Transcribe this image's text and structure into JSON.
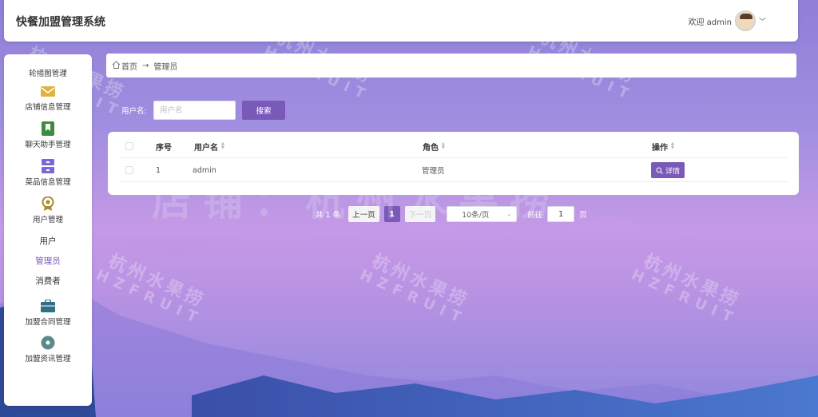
{
  "app": {
    "title": "快餐加盟管理系统"
  },
  "header": {
    "welcome": "欢迎 admin"
  },
  "breadcrumb": {
    "home": "首页",
    "arrow": "→",
    "current": "管理员"
  },
  "sidebar": {
    "items": [
      {
        "label": "轮播图管理"
      },
      {
        "label": "店铺信息管理",
        "icon": "envelope-icon"
      },
      {
        "label": "聊天助手管理",
        "icon": "bookmark-icon"
      },
      {
        "label": "菜品信息管理",
        "icon": "server-icon"
      },
      {
        "label": "用户管理",
        "icon": "badge-icon"
      },
      {
        "label": "加盟合同管理",
        "icon": "briefcase-icon"
      },
      {
        "label": "加盟资讯管理",
        "icon": "circle-icon"
      }
    ],
    "sub_items": [
      {
        "label": "用户"
      },
      {
        "label": "管理员",
        "active": true
      },
      {
        "label": "消费者"
      }
    ]
  },
  "search": {
    "label": "用户名:",
    "placeholder": "用户名",
    "button": "搜索"
  },
  "table": {
    "headers": {
      "index": "序号",
      "username": "用户名",
      "role": "角色",
      "actions": "操作"
    },
    "rows": [
      {
        "index": "1",
        "username": "admin",
        "role": "管理员",
        "action": "详情"
      }
    ]
  },
  "pagination": {
    "total": "共 1 条",
    "prev": "上一页",
    "current_page": "1",
    "next": "下一页",
    "page_size": "10条/页",
    "goto": "前往",
    "goto_value": "1",
    "page_unit": "页"
  },
  "watermark": {
    "cn": "杭州水果捞",
    "en": "HZFRUIT",
    "center": "店铺：杭州水果捞"
  },
  "colors": {
    "accent": "#7a5ab8",
    "card": "#ffffff"
  }
}
